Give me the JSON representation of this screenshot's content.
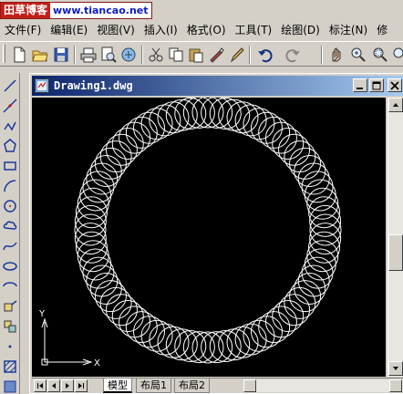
{
  "watermark": {
    "brand_cn": "田草博客",
    "url": "www.tiancao.net"
  },
  "menubar": {
    "items": [
      {
        "label": "文件(F)"
      },
      {
        "label": "编辑(E)"
      },
      {
        "label": "视图(V)"
      },
      {
        "label": "插入(I)"
      },
      {
        "label": "格式(O)"
      },
      {
        "label": "工具(T)"
      },
      {
        "label": "绘图(D)"
      },
      {
        "label": "标注(N)"
      },
      {
        "label": "修"
      }
    ]
  },
  "toolbar": {
    "icons": [
      "new-icon",
      "open-icon",
      "save-icon",
      "print-icon",
      "preview-icon",
      "publish-icon",
      "cut-icon",
      "copy-icon",
      "paste-icon",
      "match-icon",
      "brush-icon",
      "undo-icon",
      "redo-icon",
      "pan-icon",
      "zoom-realtime-icon",
      "zoom-window-icon",
      "zoom-previous-icon"
    ]
  },
  "left_toolbar": {
    "icons": [
      "line-icon",
      "construction-line-icon",
      "polyline-icon",
      "polygon-icon",
      "rectangle-icon",
      "arc-icon",
      "circle-icon",
      "revcloud-icon",
      "spline-icon",
      "ellipse-icon",
      "ellipse-arc-icon",
      "insert-block-icon",
      "make-block-icon",
      "point-icon",
      "hatch-icon",
      "region-icon"
    ]
  },
  "drawing_window": {
    "title": "Drawing1.dwg",
    "tabs": [
      {
        "label": "模型",
        "active": true
      },
      {
        "label": "布局1",
        "active": false
      },
      {
        "label": "布局2",
        "active": false
      }
    ],
    "ucs": {
      "y_label": "Y",
      "x_label": "X"
    }
  },
  "colors": {
    "titlebar_start": "#0a246a",
    "titlebar_end": "#a6caf0",
    "canvas_bg": "#000000",
    "drawing_stroke": "#ffffff",
    "watermark_red": "#c0211a",
    "watermark_blue": "#0b1cc4"
  }
}
